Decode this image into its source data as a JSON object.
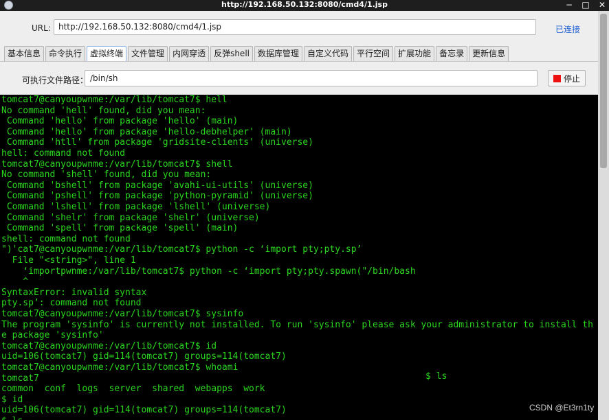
{
  "window": {
    "title": "http://192.168.50.132:8080/cmd4/1.jsp"
  },
  "url_bar": {
    "label": "URL:",
    "value": "http://192.168.50.132:8080/cmd4/1.jsp",
    "status": "已连接"
  },
  "tabs": [
    {
      "label": "基本信息"
    },
    {
      "label": "命令执行"
    },
    {
      "label": "虚拟终端"
    },
    {
      "label": "文件管理"
    },
    {
      "label": "内网穿透"
    },
    {
      "label": "反弹shell"
    },
    {
      "label": "数据库管理"
    },
    {
      "label": "自定义代码"
    },
    {
      "label": "平行空间"
    },
    {
      "label": "扩展功能"
    },
    {
      "label": "备忘录"
    },
    {
      "label": "更新信息"
    }
  ],
  "active_tab": "虚拟终端",
  "exec_path": {
    "label": "可执行文件路径：",
    "value": "/bin/sh",
    "stop_label": "停止"
  },
  "terminal": {
    "text_color": "#2bd61f",
    "lines": [
      "tomcat7@canyoupwnme:/var/lib/tomcat7$ hell",
      "No command 'hell' found, did you mean:",
      " Command 'hello' from package 'hello' (main)",
      " Command 'hello' from package 'hello-debhelper' (main)",
      " Command 'htll' from package 'gridsite-clients' (universe)",
      "hell: command not found",
      "tomcat7@canyoupwnme:/var/lib/tomcat7$ shell",
      "No command 'shell' found, did you mean:",
      " Command 'bshell' from package 'avahi-ui-utils' (universe)",
      " Command 'pshell' from package 'python-pyramid' (universe)",
      " Command 'lshell' from package 'lshell' (universe)",
      " Command 'shelr' from package 'shelr' (universe)",
      " Command 'spell' from package 'spell' (main)",
      "shell: command not found",
      "\")'cat7@canyoupwnme:/var/lib/tomcat7$ python -c ‘import pty;pty.sp’",
      "  File \"<string>\", line 1",
      "    ‘importpwnme:/var/lib/tomcat7$ python -c ‘import pty;pty.spawn(\"/bin/bash",
      "    ^",
      "SyntaxError: invalid syntax",
      "pty.sp’: command not found",
      "tomcat7@canyoupwnme:/var/lib/tomcat7$ sysinfo",
      "The program 'sysinfo' is currently not installed. To run 'sysinfo' please ask your administrator to install th",
      "e package 'sysinfo'",
      "tomcat7@canyoupwnme:/var/lib/tomcat7$ id",
      "uid=106(tomcat7) gid=114(tomcat7) groups=114(tomcat7)",
      "tomcat7@canyoupwnme:/var/lib/tomcat7$ whoami",
      "tomcat7",
      "common  conf  logs  server  shared  webapps  work",
      "$ id",
      "uid=106(tomcat7) gid=114(tomcat7) groups=114(tomcat7)",
      "$ ls"
    ],
    "side_text": "$ ls"
  },
  "watermark": "CSDN @Et3rn1ty"
}
